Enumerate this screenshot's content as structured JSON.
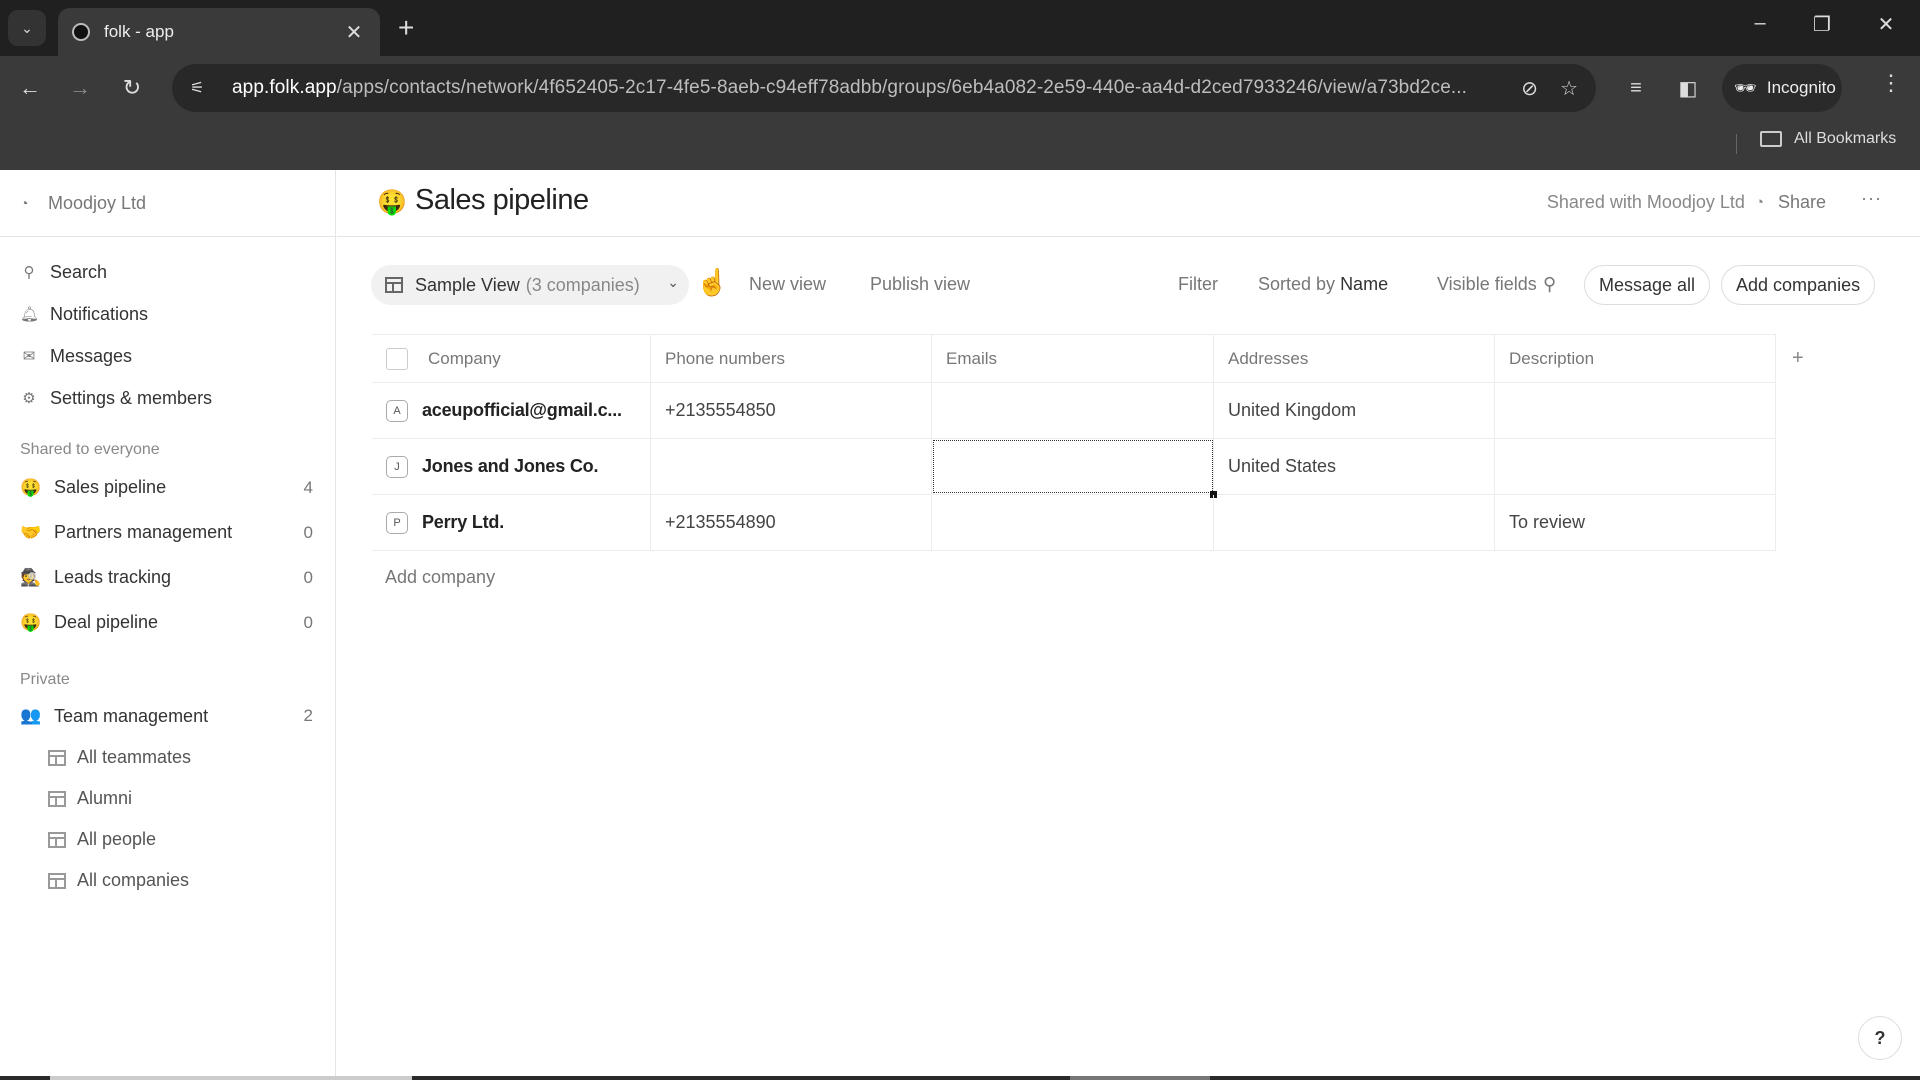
{
  "browser": {
    "tab_title": "folk - app",
    "url_host": "app.folk.app",
    "url_path": "/apps/contacts/network/4f652405-2c17-4fe5-8aeb-c94eff78adbb/groups/6eb4a082-2e59-440e-aa4d-d2ced7933246/view/a73bd2ce...",
    "incognito_label": "Incognito",
    "bookmarks_label": "All Bookmarks"
  },
  "sidebar": {
    "workspace": "Moodjoy Ltd",
    "nav": [
      {
        "label": "Search",
        "icon": "search-icon"
      },
      {
        "label": "Notifications",
        "icon": "bell-icon"
      },
      {
        "label": "Messages",
        "icon": "mail-icon"
      },
      {
        "label": "Settings & members",
        "icon": "gear-icon"
      }
    ],
    "shared_section": "Shared to everyone",
    "shared_groups": [
      {
        "label": "Sales pipeline",
        "count": "4",
        "emoji": "🤑"
      },
      {
        "label": "Partners management",
        "count": "0",
        "emoji": "🤝"
      },
      {
        "label": "Leads tracking",
        "count": "0",
        "emoji": "🕵️"
      },
      {
        "label": "Deal pipeline",
        "count": "0",
        "emoji": "🤑"
      }
    ],
    "private_section": "Private",
    "private_group": {
      "label": "Team management",
      "count": "2",
      "emoji": "👥"
    },
    "private_views": [
      "All teammates",
      "Alumni",
      "All people",
      "All companies"
    ]
  },
  "header": {
    "emoji": "🤑",
    "title": "Sales pipeline",
    "shared_with": "Shared with Moodjoy Ltd",
    "share": "Share",
    "more": "···"
  },
  "view_bar": {
    "view_name": "Sample View",
    "view_count": "(3 companies)",
    "new_view": "New view",
    "publish_view": "Publish view",
    "filter": "Filter",
    "sorted_by_prefix": "Sorted by",
    "sorted_by_field": "Name",
    "visible_fields": "Visible fields",
    "message_all": "Message all",
    "add_companies": "Add companies"
  },
  "table": {
    "columns": [
      "Company",
      "Phone numbers",
      "Emails",
      "Addresses",
      "Description"
    ],
    "rows": [
      {
        "initial": "A",
        "company": "aceupofficial@gmail.c...",
        "phone": "+2135554850",
        "email": "",
        "address": "United Kingdom",
        "description": ""
      },
      {
        "initial": "J",
        "company": "Jones and Jones Co.",
        "phone": "",
        "email": "",
        "address": "United States",
        "description": ""
      },
      {
        "initial": "P",
        "company": "Perry Ltd.",
        "phone": "+2135554890",
        "email": "",
        "address": "",
        "description": "To review"
      }
    ],
    "add_column": "+",
    "add_row": "Add company"
  },
  "help": "?"
}
